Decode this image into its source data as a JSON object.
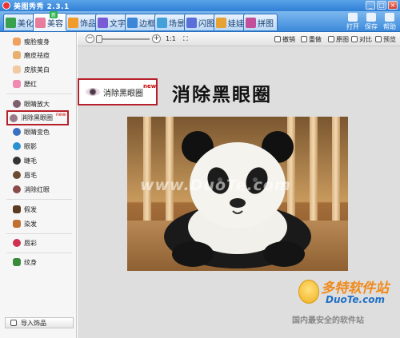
{
  "app": {
    "title": "美图秀秀 2.3.1"
  },
  "window_controls": [
    "_",
    "□",
    "×"
  ],
  "tabs": [
    {
      "label": "美化",
      "color": "#3aa14f"
    },
    {
      "label": "美容",
      "color": "#e77c9c",
      "badge": "新"
    },
    {
      "label": "饰品",
      "color": "#f09b2a"
    },
    {
      "label": "文字",
      "color": "#7a5bd6"
    },
    {
      "label": "边框",
      "color": "#3d86d8"
    },
    {
      "label": "场景",
      "color": "#44a0d8"
    },
    {
      "label": "闪图",
      "color": "#5a6fd8"
    },
    {
      "label": "娃娃",
      "color": "#e6a235"
    },
    {
      "label": "拼图",
      "color": "#c2509a"
    }
  ],
  "top_right": [
    {
      "label": "打开",
      "icon": "folder-icon"
    },
    {
      "label": "保存",
      "icon": "save-icon"
    },
    {
      "label": "帮助",
      "icon": "help-icon"
    }
  ],
  "sidebar": {
    "items": [
      {
        "label": "瘦脸瘦身",
        "icon_color": "#f0a060"
      },
      {
        "label": "磨皮祛痘",
        "icon_color": "#e8b070"
      },
      {
        "label": "皮肤美白",
        "icon_color": "#f2c9a0"
      },
      {
        "label": "腮红",
        "icon_color": "#f08ab0"
      },
      {
        "label": "眼睛放大",
        "icon_color": "#806070"
      },
      {
        "label": "消除黑眼圈",
        "icon_color": "#9a7a8a",
        "new": "new"
      },
      {
        "label": "眼睛变色",
        "icon_color": "#3a70c0"
      },
      {
        "label": "眼影",
        "icon_color": "#2a90d0"
      },
      {
        "label": "睫毛",
        "icon_color": "#333333"
      },
      {
        "label": "眉毛",
        "icon_color": "#6a4a30"
      },
      {
        "label": "消除红眼",
        "icon_color": "#8a4a4a"
      },
      {
        "label": "假发",
        "icon_color": "#5a3a20"
      },
      {
        "label": "染发",
        "icon_color": "#c07030"
      },
      {
        "label": "唇彩",
        "icon_color": "#d03050"
      },
      {
        "label": "纹身",
        "icon_color": "#3a8a3a"
      }
    ],
    "import_label": "导入饰品"
  },
  "toolbar": {
    "zoom_out": "−",
    "zoom_in": "+",
    "zoom_ratio": "1:1",
    "undo": "撤销",
    "redo": "重做",
    "original": "原图",
    "compare": "对比",
    "preview": "预览"
  },
  "callout": {
    "label": "消除黑眼圈",
    "new": "new"
  },
  "heading": "消除黑眼圈",
  "photo": {
    "watermark": "www.DuoTe.com"
  },
  "logo": {
    "main": "多特软件站",
    "sub": "DuoTe.com",
    "tagline": "国内最安全的软件站"
  }
}
